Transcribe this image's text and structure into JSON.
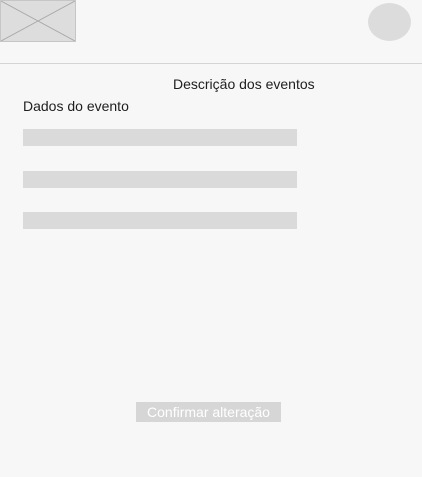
{
  "header": {
    "logo_icon": "image-placeholder-icon",
    "avatar_icon": "user-avatar-icon"
  },
  "page_title": "Descrição dos eventos",
  "form": {
    "section_title": "Dados do evento",
    "fields": [
      {
        "value": "",
        "placeholder": ""
      },
      {
        "value": "",
        "placeholder": ""
      },
      {
        "value": "",
        "placeholder": ""
      }
    ],
    "confirm_label": "Confirmar alteração"
  },
  "colors": {
    "background": "#f7f7f7",
    "placeholder_gray": "#dadada",
    "button_gray": "#d6d6d6",
    "button_text": "#ffffff",
    "divider": "#d4d4d4"
  }
}
